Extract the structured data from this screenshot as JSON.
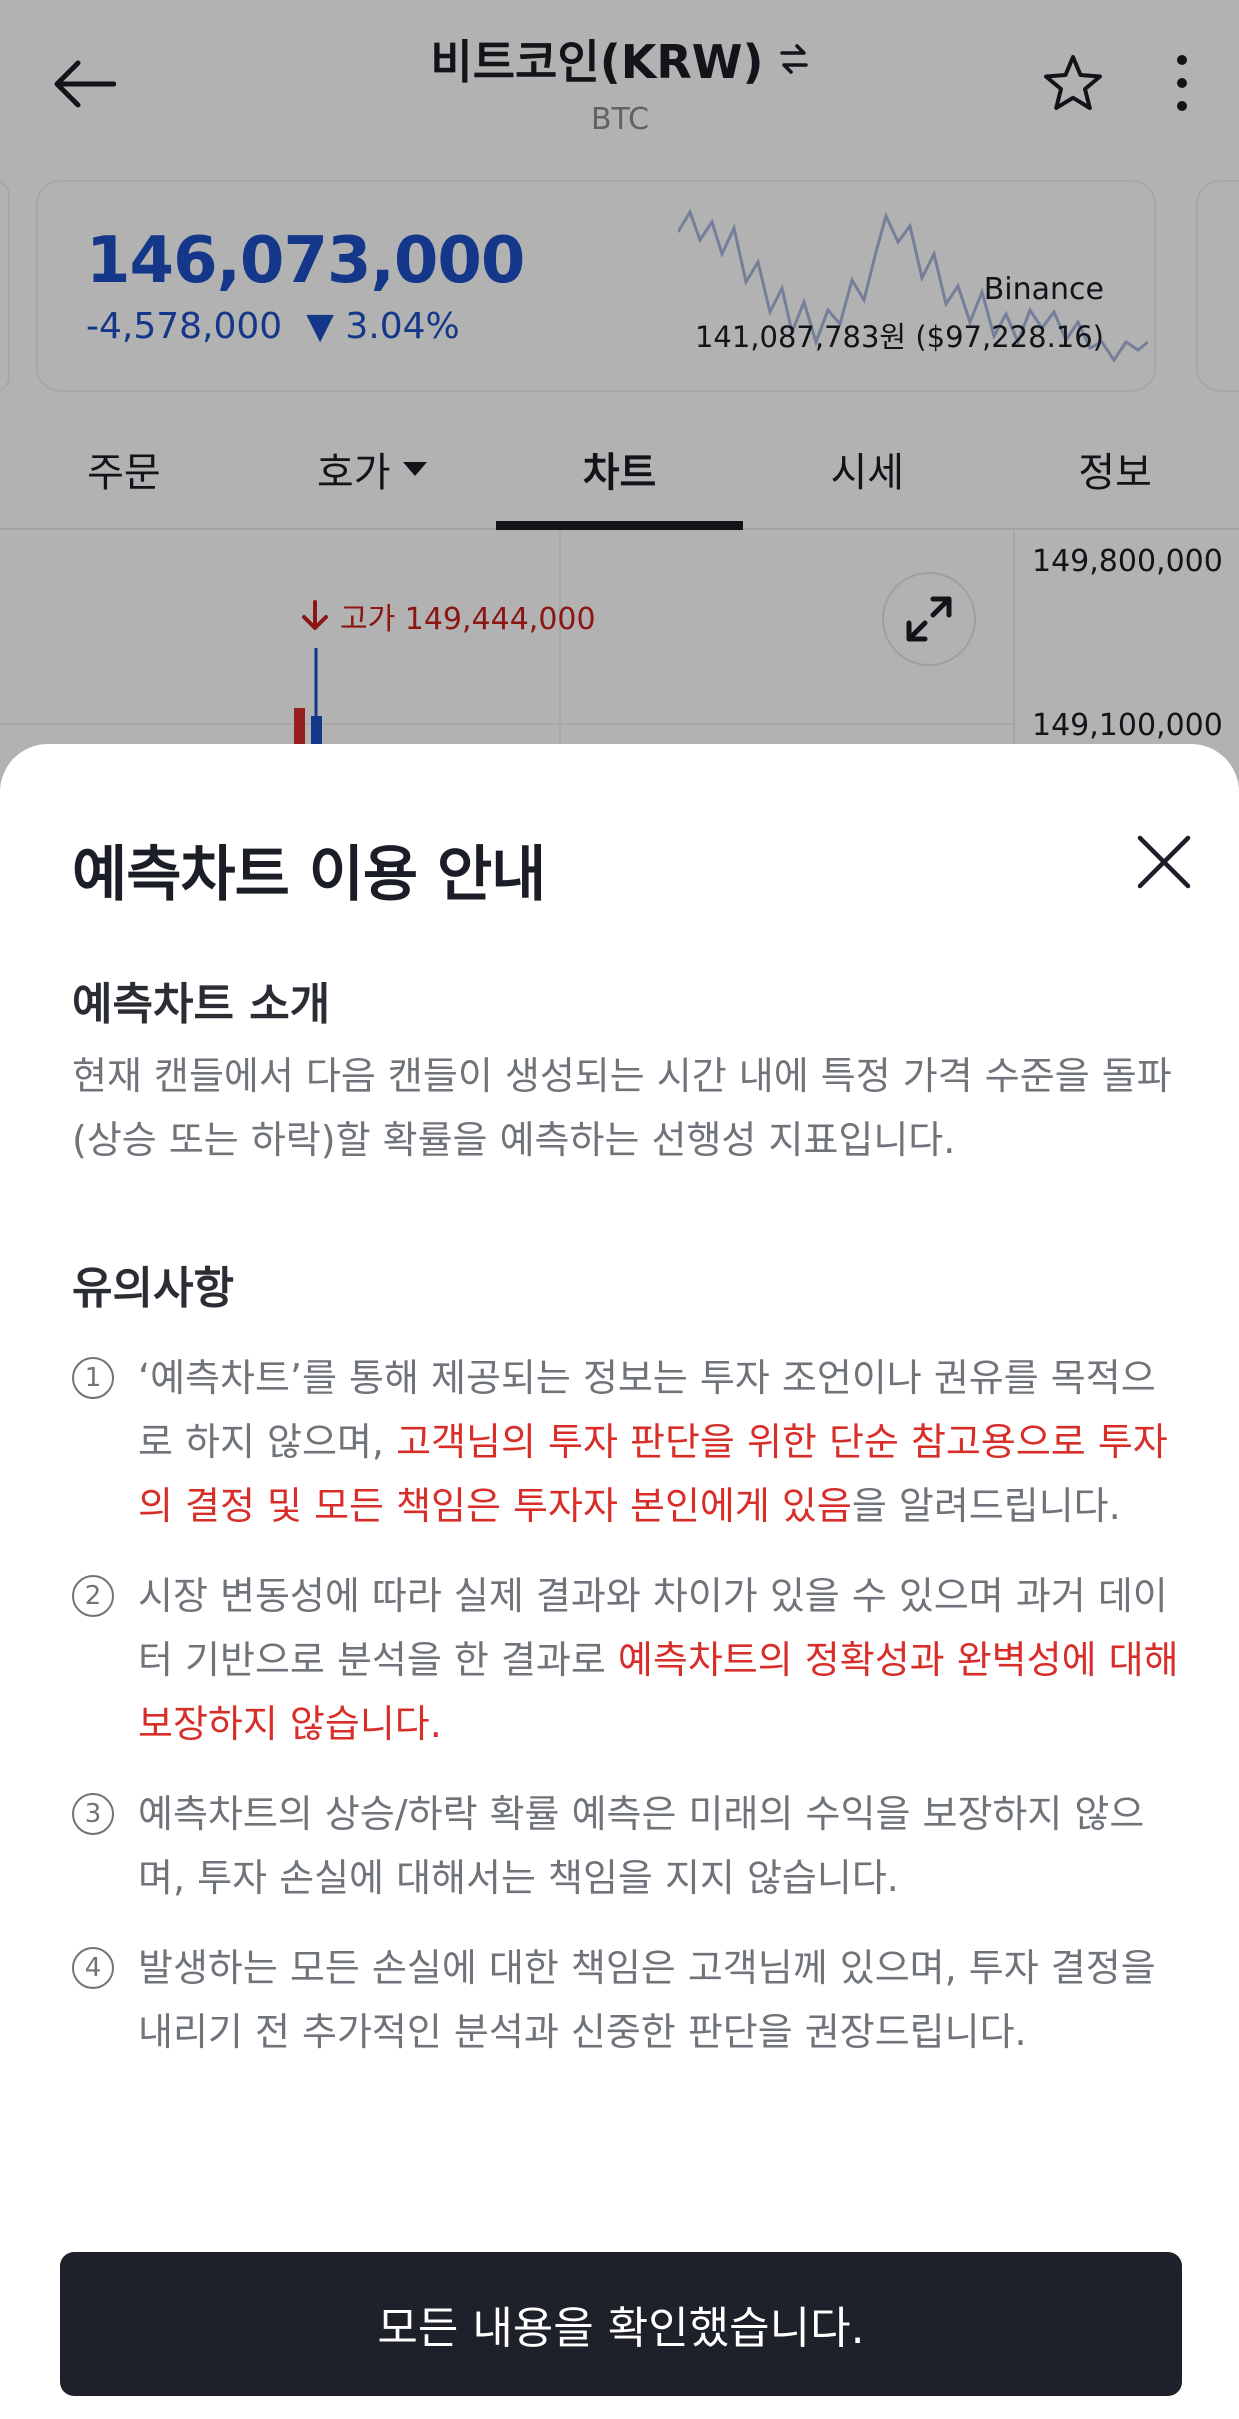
{
  "header": {
    "title": "비트코인(KRW)",
    "subtitle": "BTC",
    "icons": {
      "back": "arrow-left-icon",
      "swap": "swap-icon",
      "favorite": "star-icon",
      "more": "more-vertical-icon"
    }
  },
  "price_card": {
    "price": "146,073,000",
    "change_amount": "-4,578,000",
    "change_percent": "▼ 3.04%",
    "reference_exchange": "Binance",
    "reference_price": "141,087,783원 ($97,228.16)",
    "color_down": "#1e4fc4"
  },
  "tabs": [
    {
      "label": "주문"
    },
    {
      "label": "호가"
    },
    {
      "label": "차트",
      "active": true
    },
    {
      "label": "시세"
    },
    {
      "label": "정보"
    }
  ],
  "chart": {
    "y_labels": [
      "149,800,000",
      "149,100,000"
    ],
    "high_label": "고가 149,444,000",
    "color_up": "#d72e2a"
  },
  "modal": {
    "title": "예측차트 이용 안내",
    "intro_heading": "예측차트 소개",
    "intro_text": "현재 캔들에서 다음 캔들이 생성되는 시간 내에 특정 가격 수준을 돌파(상승 또는 하락)할 확률을 예측하는 선행성 지표입니다.",
    "notes_heading": "유의사항",
    "notes": [
      {
        "num": "1",
        "before": "‘예측차트’를 통해 제공되는 정보는 투자 조언이나 권유를 목적으로 하지 않으며, ",
        "highlight": "고객님의 투자 판단을 위한 단순 참고용으로 투자의 결정 및 모든 책임은 투자자 본인에게 있음",
        "after": "을 알려드립니다."
      },
      {
        "num": "2",
        "before": "시장 변동성에 따라 실제 결과와 차이가 있을 수 있으며 과거 데이터 기반으로 분석을 한 결과로 ",
        "highlight": "예측차트의 정확성과 완벽성에 대해 보장하지 않습니다.",
        "after": ""
      },
      {
        "num": "3",
        "before": "예측차트의 상승/하락 확률 예측은 미래의 수익을 보장하지 않으며, 투자 손실에 대해서는 책임을 지지 않습니다.",
        "highlight": "",
        "after": ""
      },
      {
        "num": "4",
        "before": "발생하는 모든 손실에 대한 책임은 고객님께 있으며, 투자 결정을 내리기 전 추가적인 분석과 신중한 판단을 권장드립니다.",
        "highlight": "",
        "after": ""
      }
    ],
    "confirm_label": "모든 내용을 확인했습니다.",
    "highlight_color": "#d72e2a"
  }
}
